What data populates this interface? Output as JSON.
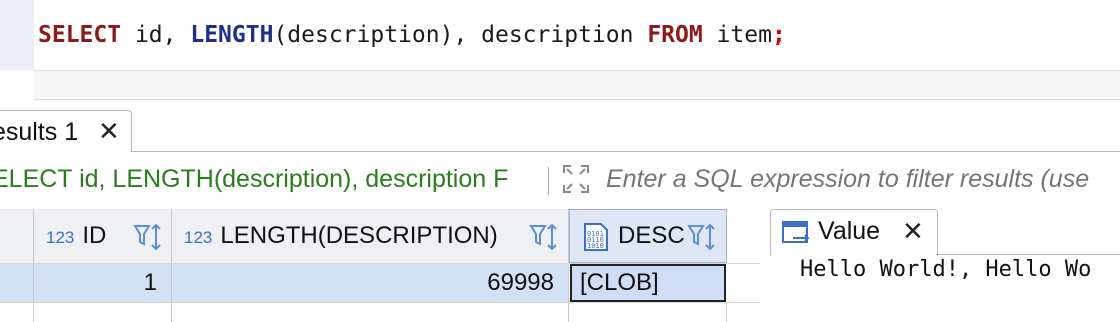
{
  "editor": {
    "tokens": {
      "select": "SELECT",
      "t1": " id, ",
      "length": "LENGTH",
      "t2": "(description), description ",
      "from": "FROM",
      "t3": " item",
      "semi": ";"
    }
  },
  "results_tab": {
    "label": "esults 1",
    "close": "✕"
  },
  "filter": {
    "query": "ELECT id, LENGTH(description), description F",
    "placeholder": "Enter a SQL expression to filter results (use"
  },
  "grid": {
    "columns": [
      {
        "type_tag": "123",
        "label": "ID"
      },
      {
        "type_tag": "123",
        "label": "LENGTH(DESCRIPTION)"
      },
      {
        "type_tag": "",
        "label": "DESC"
      }
    ],
    "rows": [
      {
        "id": "1",
        "length": "69998",
        "description": "[CLOB]"
      }
    ]
  },
  "value_panel": {
    "tab_label": "Value",
    "close": "✕",
    "content": "Hello World!, Hello Wo"
  },
  "colors": {
    "keyword_red": "#8b1a1a",
    "keyword_blue": "#1f2f87",
    "filter_green": "#2a7d1c",
    "selection": "#d3e1f5",
    "type_tag_blue": "#3c6fc9"
  },
  "icons": {
    "filter_sort": "filter-sort-icon",
    "expand": "expand-icon",
    "binary": "binary-data-icon",
    "value_panel": "value-panel-icon",
    "close": "close-icon"
  }
}
